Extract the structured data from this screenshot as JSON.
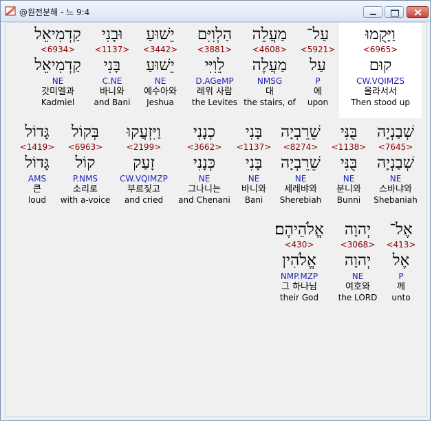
{
  "window": {
    "title": "@원전분해 - 느 9:4"
  },
  "rows": [
    {
      "words": [
        {
          "hebrew": "וַיָּקֻמוּ",
          "strong": "<6965>",
          "lemma": "קוּם",
          "parsing": "CW.VQIMZS",
          "korean": "올라서서",
          "english": "Then stood up",
          "selected": true
        },
        {
          "hebrew": "עַל־",
          "strong": "<5921>",
          "lemma": "עַל",
          "parsing": "P",
          "korean": "에",
          "english": "upon",
          "selected": false
        },
        {
          "hebrew": "מַעֲלֵה",
          "strong": "<4608>",
          "lemma": "מַעֲלֶה",
          "parsing": "NMSG",
          "korean": "대",
          "english": "the stairs, of",
          "selected": false
        },
        {
          "hebrew": "הַלְוִיִּם",
          "strong": "<3881>",
          "lemma": "לֵוִיִּי",
          "parsing": "D.AGeMP",
          "korean": "레위 사람",
          "english": "the Levites",
          "selected": false
        },
        {
          "hebrew": "יֵשׁוּעַ",
          "strong": "<3442>",
          "lemma": "יֵשׁוּעַ",
          "parsing": "NE",
          "korean": "예수아와",
          "english": "Jeshua",
          "selected": false
        },
        {
          "hebrew": "וּבָנִי",
          "strong": "<1137>",
          "lemma": "בָּנִי",
          "parsing": "C.NE",
          "korean": "바니와",
          "english": "and Bani",
          "selected": false
        },
        {
          "hebrew": "קַדְמִיאֵל",
          "strong": "<6934>",
          "lemma": "קַדְמִיאֵל",
          "parsing": "NE",
          "korean": "갓미엘과",
          "english": "Kadmiel",
          "selected": false
        }
      ]
    },
    {
      "words": [
        {
          "hebrew": "שְׁבַנְיָה",
          "strong": "<7645>",
          "lemma": "שְׁבַנְיָה",
          "parsing": "NE",
          "korean": "스바냐와",
          "english": "Shebaniah",
          "selected": false
        },
        {
          "hebrew": "בֻּנִּי",
          "strong": "<1138>",
          "lemma": "בֻּנִּי",
          "parsing": "NE",
          "korean": "분니와",
          "english": "Bunni",
          "selected": false
        },
        {
          "hebrew": "שֵׁרֵבְיָה",
          "strong": "<8274>",
          "lemma": "שֵׁרֵבְיָה",
          "parsing": "NE",
          "korean": "세레뱌와",
          "english": "Sherebiah",
          "selected": false
        },
        {
          "hebrew": "בָּנִי",
          "strong": "<1137>",
          "lemma": "בָּנִי",
          "parsing": "NE",
          "korean": "바니와",
          "english": "Bani",
          "selected": false
        },
        {
          "hebrew": "כְנָנִי",
          "strong": "<3662>",
          "lemma": "כְּנָנִי",
          "parsing": "NE",
          "korean": "그나니는",
          "english": "and Chenani",
          "selected": false
        },
        {
          "hebrew": "וַיִּזְעֲקוּ",
          "strong": "<2199>",
          "lemma": "זָעַק",
          "parsing": "CW.VQIMZP",
          "korean": "부르짖고",
          "english": "and cried",
          "selected": false
        },
        {
          "hebrew": "בְּקוֹל",
          "strong": "<6963>",
          "lemma": "קוֹל",
          "parsing": "P.NMS",
          "korean": "소리로",
          "english": "with a-voice",
          "selected": false
        },
        {
          "hebrew": "גָּדוֹל",
          "strong": "<1419>",
          "lemma": "גָּדוֹל",
          "parsing": "AMS",
          "korean": "큰",
          "english": "loud",
          "selected": false
        }
      ]
    },
    {
      "words": [
        {
          "hebrew": "אֶל־",
          "strong": "<413>",
          "lemma": "אֶל",
          "parsing": "P",
          "korean": "께",
          "english": "unto",
          "selected": false
        },
        {
          "hebrew": "יְהוָה",
          "strong": "<3068>",
          "lemma": "יְהוָה",
          "parsing": "NE",
          "korean": "여호와",
          "english": "the LORD",
          "selected": false
        },
        {
          "hebrew": "אֱלֹהֵיהֶם׃",
          "strong": "<430>",
          "lemma": "אֱלֹהִין",
          "parsing": "NMP.MZP",
          "korean": "그 하나님",
          "english": "their God",
          "selected": false
        }
      ]
    }
  ]
}
